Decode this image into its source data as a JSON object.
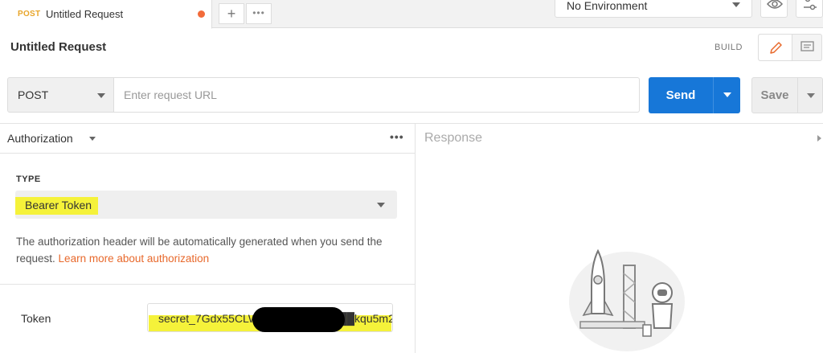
{
  "tabs": [
    {
      "method": "POST",
      "title": "Untitled Request",
      "unsaved": true
    }
  ],
  "tabbar": {
    "add_icon": "plus-icon",
    "more_icon": "more-horizontal-icon"
  },
  "environment": {
    "selected": "No Environment"
  },
  "request": {
    "title": "Untitled Request",
    "mode_label": "BUILD"
  },
  "url_bar": {
    "method": "POST",
    "url_value": "",
    "url_placeholder": "Enter request URL",
    "send_label": "Send",
    "save_label": "Save"
  },
  "auth": {
    "section_label": "Authorization",
    "more_label": "•••",
    "type_label": "TYPE",
    "type_value": "Bearer Token",
    "description": "The authorization header will be automatically generated when you send the request.",
    "link_text": "Learn more about authorization",
    "token_label": "Token",
    "token_value": "secret_7Gdx55CLW████████████kqu5m2"
  },
  "response": {
    "label": "Response"
  },
  "colors": {
    "accent_orange": "#e8692c",
    "send_blue": "#1777d8",
    "highlight_yellow": "#f5f23a",
    "post_method": "#e8a52a"
  }
}
